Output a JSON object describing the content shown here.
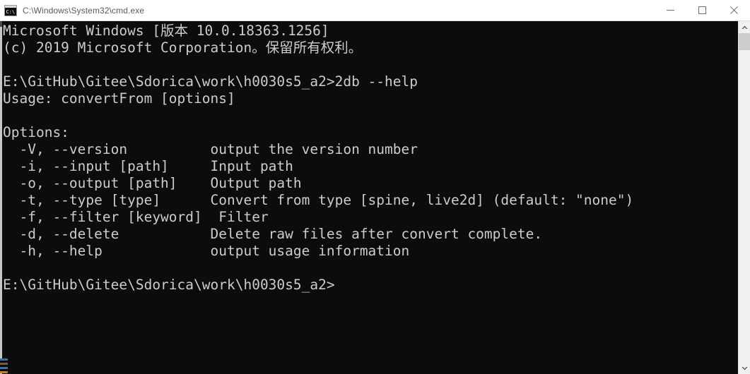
{
  "window": {
    "title": "C:\\Windows\\System32\\cmd.exe",
    "icon": "cmd-console-icon",
    "controls": {
      "minimize": "minimize-icon",
      "maximize": "maximize-icon",
      "close": "close-icon"
    },
    "colors": {
      "titlebar_bg": "#ffffff",
      "titlebar_text": "#5a5a5a",
      "console_bg": "#0c0c0c",
      "console_text": "#ccccd0",
      "scrollbar_track": "#f0f0f0",
      "scrollbar_thumb": "#cdcdcd"
    }
  },
  "scrollbar": {
    "up_arrow": "chevron-up-icon",
    "down_arrow": "chevron-down-icon"
  },
  "console": {
    "lines": [
      "Microsoft Windows [版本 10.0.18363.1256]",
      "(c) 2019 Microsoft Corporation。保留所有权利。",
      "",
      "E:\\GitHub\\Gitee\\Sdorica\\work\\h0030s5_a2>2db --help",
      "Usage: convertFrom [options]",
      "",
      "Options:",
      "  -V, --version          output the version number",
      "  -i, --input [path]     Input path",
      "  -o, --output [path]    Output path",
      "  -t, --type [type]      Convert from type [spine, live2d] (default: \"none\")",
      "  -f, --filter [keyword]  Filter",
      "  -d, --delete           Delete raw files after convert complete.",
      "  -h, --help             output usage information",
      "",
      "E:\\GitHub\\Gitee\\Sdorica\\work\\h0030s5_a2>"
    ],
    "command_entered": "2db --help",
    "prompt": "E:\\GitHub\\Gitee\\Sdorica\\work\\h0030s5_a2>",
    "usage": "Usage: convertFrom [options]",
    "options_header": "Options:",
    "options": [
      {
        "flags": "-V, --version",
        "arg": "",
        "description": "output the version number"
      },
      {
        "flags": "-i, --input",
        "arg": "[path]",
        "description": "Input path"
      },
      {
        "flags": "-o, --output",
        "arg": "[path]",
        "description": "Output path"
      },
      {
        "flags": "-t, --type",
        "arg": "[type]",
        "description": "Convert from type [spine, live2d] (default: \"none\")"
      },
      {
        "flags": "-f, --filter",
        "arg": "[keyword]",
        "description": "Filter"
      },
      {
        "flags": "-d, --delete",
        "arg": "",
        "description": "Delete raw files after convert complete."
      },
      {
        "flags": "-h, --help",
        "arg": "",
        "description": "output usage information"
      }
    ]
  }
}
